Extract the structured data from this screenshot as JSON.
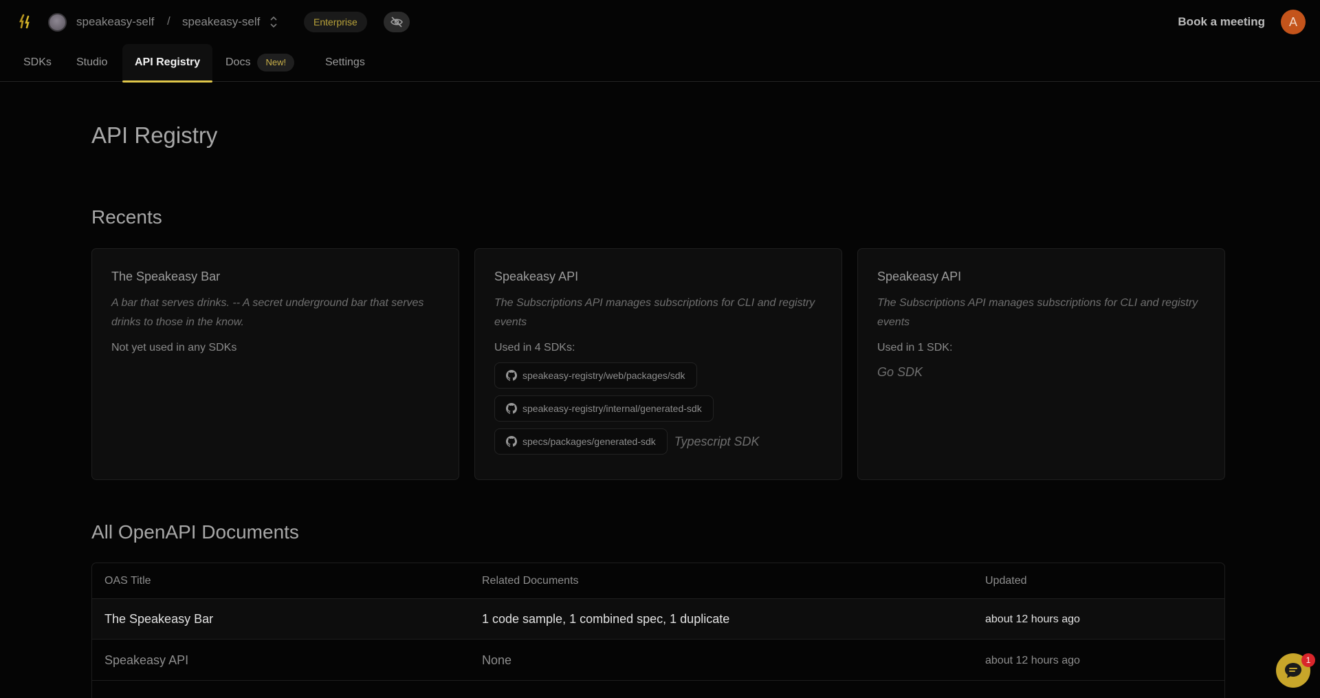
{
  "header": {
    "org_name": "speakeasy-self",
    "separator": "/",
    "project_name": "speakeasy-self",
    "plan_badge": "Enterprise",
    "book_meeting": "Book a meeting",
    "user_initial": "A"
  },
  "tabs": [
    {
      "label": "SDKs"
    },
    {
      "label": "Studio"
    },
    {
      "label": "API Registry",
      "active": true
    },
    {
      "label": "Docs",
      "badge": "New!"
    },
    {
      "label": "Settings"
    }
  ],
  "page_title": "API Registry",
  "recents": {
    "title": "Recents",
    "cards": [
      {
        "title": "The Speakeasy Bar",
        "description": "A bar that serves drinks. -- A secret underground bar that serves drinks to those in the know.",
        "usage": "Not yet used in any SDKs"
      },
      {
        "title": "Speakeasy API",
        "description": "The Subscriptions API manages subscriptions for CLI and registry events",
        "usage": "Used in 4 SDKs:",
        "repos": [
          "speakeasy-registry/web/packages/sdk",
          "speakeasy-registry/internal/generated-sdk",
          "specs/packages/generated-sdk"
        ],
        "extra_sdk": "Typescript SDK"
      },
      {
        "title": "Speakeasy API",
        "description": "The Subscriptions API manages subscriptions for CLI and registry events",
        "usage": "Used in 1 SDK:",
        "extra_sdk": "Go SDK"
      }
    ]
  },
  "documents": {
    "title": "All OpenAPI Documents",
    "columns": [
      "OAS Title",
      "Related Documents",
      "Updated"
    ],
    "rows": [
      {
        "title": "The Speakeasy Bar",
        "related": "1 code sample, 1 combined spec, 1 duplicate",
        "updated": "about 12 hours ago"
      },
      {
        "title": "Speakeasy API",
        "related": "None",
        "updated": "about 12 hours ago"
      }
    ]
  },
  "chat": {
    "unread": "1"
  },
  "colors": {
    "accent": "#e0c74a",
    "avatar": "#c4541b",
    "chat": "#c8a62a"
  }
}
